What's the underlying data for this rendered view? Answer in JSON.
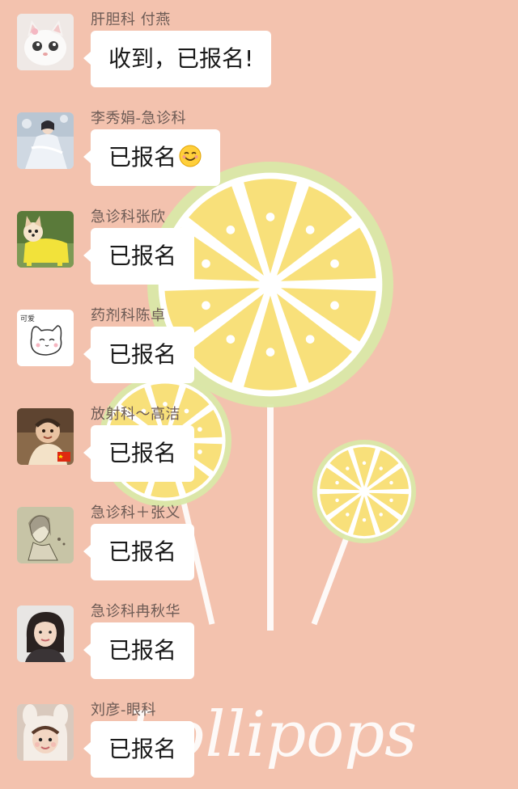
{
  "background": {
    "color": "#f3c2ae",
    "watermark_text": "Lollipops"
  },
  "messages": [
    {
      "sender": "肝胆科 付燕",
      "text": "收到，已报名!",
      "emoji": "",
      "avatar": "kitten-photo"
    },
    {
      "sender": "李秀娟-急诊科",
      "text": "已报名",
      "emoji": "smiling-face",
      "avatar": "woman-in-white-dress"
    },
    {
      "sender": "急诊科张欣",
      "text": "已报名",
      "emoji": "",
      "avatar": "dog-in-yellow-raincoat"
    },
    {
      "sender": "药剂科陈卓",
      "text": "已报名",
      "emoji": "",
      "avatar": "cartoon-white-cat",
      "avatar_text": "可爱"
    },
    {
      "sender": "放射科～高洁",
      "text": "已报名",
      "emoji": "",
      "avatar": "baby-with-flag"
    },
    {
      "sender": "急诊科＋张义",
      "text": "已报名",
      "emoji": "",
      "avatar": "girl-illustration"
    },
    {
      "sender": "急诊科冉秋华",
      "text": "已报名",
      "emoji": "",
      "avatar": "woman-selfie"
    },
    {
      "sender": "刘彦-眼科",
      "text": "已报名",
      "emoji": "",
      "avatar": "child-in-bunny-hat"
    }
  ]
}
